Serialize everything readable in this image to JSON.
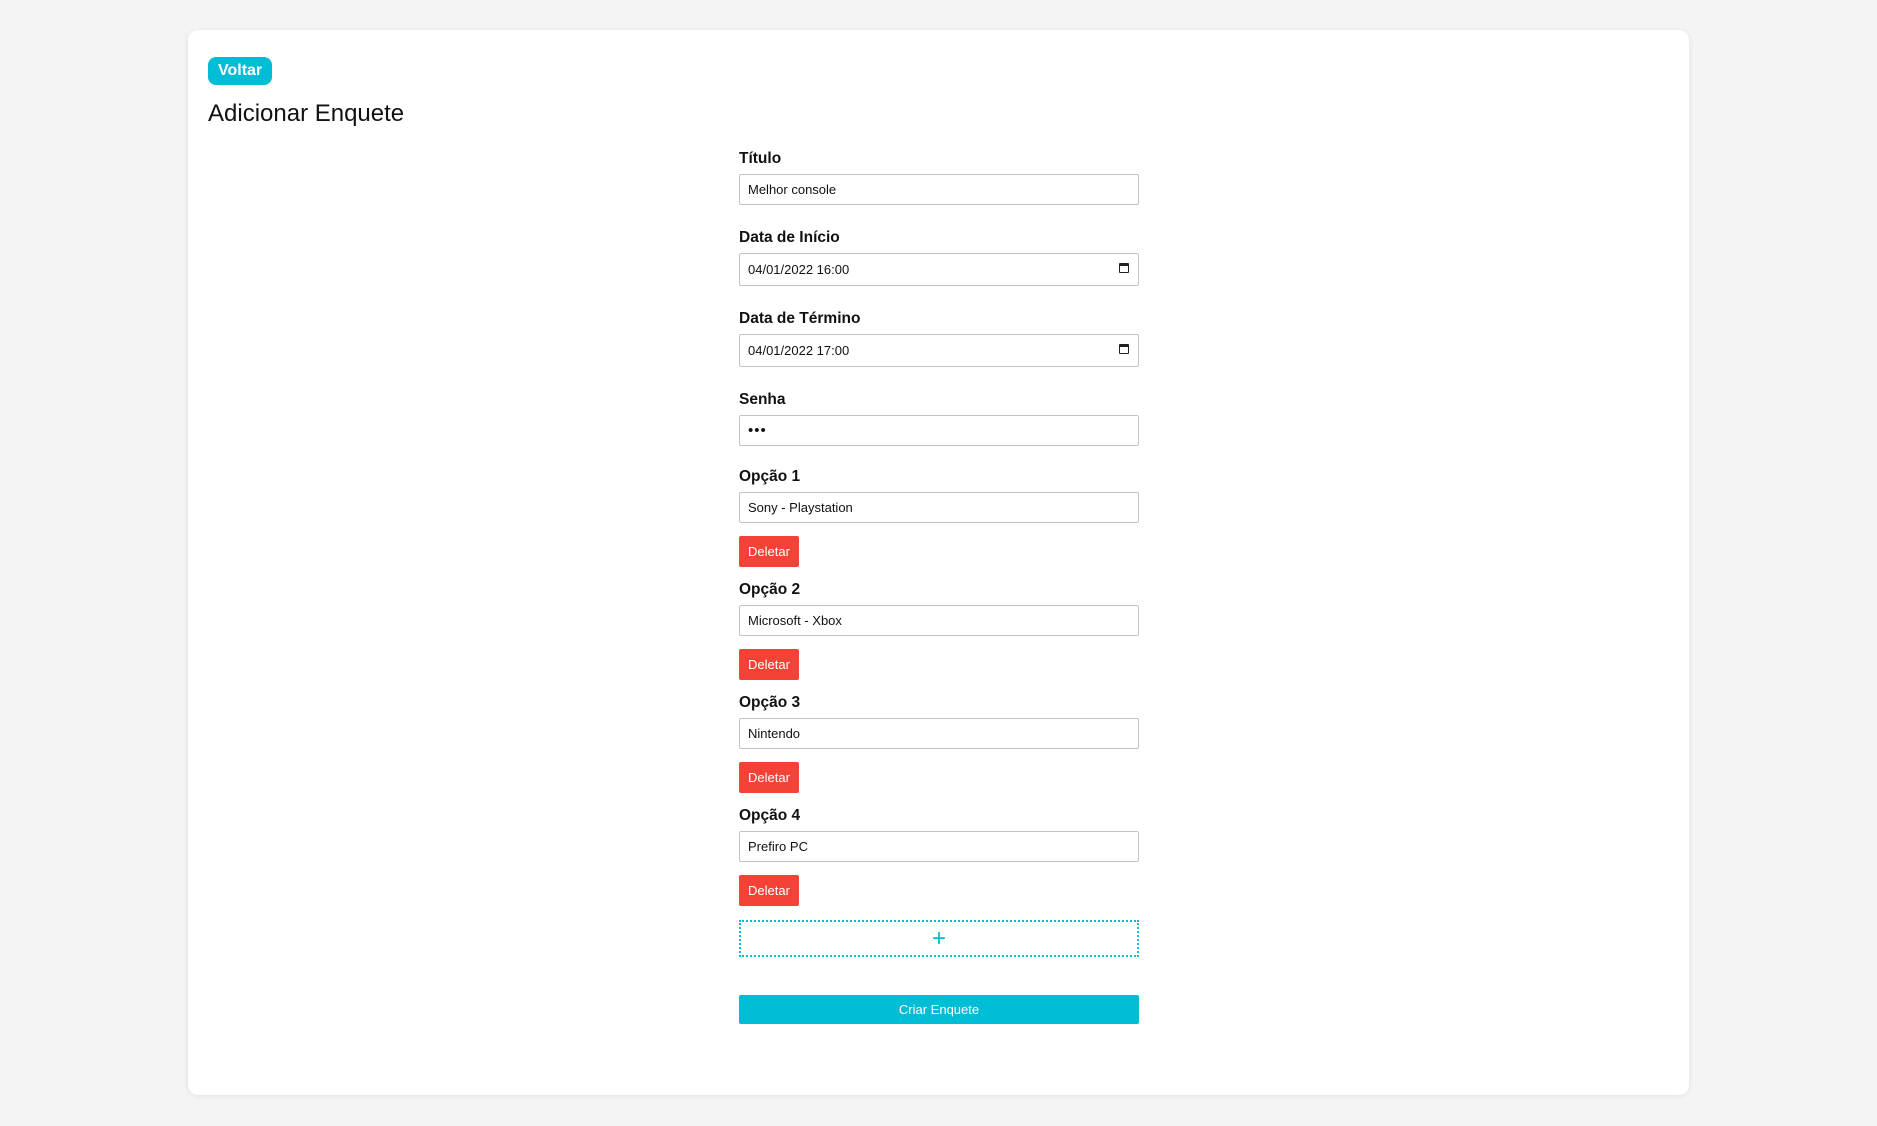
{
  "header": {
    "back_label": "Voltar",
    "title": "Adicionar Enquete"
  },
  "form": {
    "titulo": {
      "label": "Título",
      "value": "Melhor console"
    },
    "data_inicio": {
      "label": "Data de Início",
      "value": "04/01/2022 16:00"
    },
    "data_termino": {
      "label": "Data de Término",
      "value": "04/01/2022 17:00"
    },
    "senha": {
      "label": "Senha",
      "value": "•••"
    },
    "options": [
      {
        "label": "Opção 1",
        "value": "Sony - Playstation",
        "delete_label": "Deletar"
      },
      {
        "label": "Opção 2",
        "value": "Microsoft - Xbox",
        "delete_label": "Deletar"
      },
      {
        "label": "Opção 3",
        "value": "Nintendo",
        "delete_label": "Deletar"
      },
      {
        "label": "Opção 4",
        "value": "Prefiro PC",
        "delete_label": "Deletar"
      }
    ],
    "add_option_label": "+",
    "submit_label": "Criar Enquete"
  },
  "colors": {
    "accent": "#00bcd4",
    "danger": "#f44336",
    "background": "#f4f4f4"
  },
  "icons": {
    "date_picker": "calendar-icon"
  }
}
